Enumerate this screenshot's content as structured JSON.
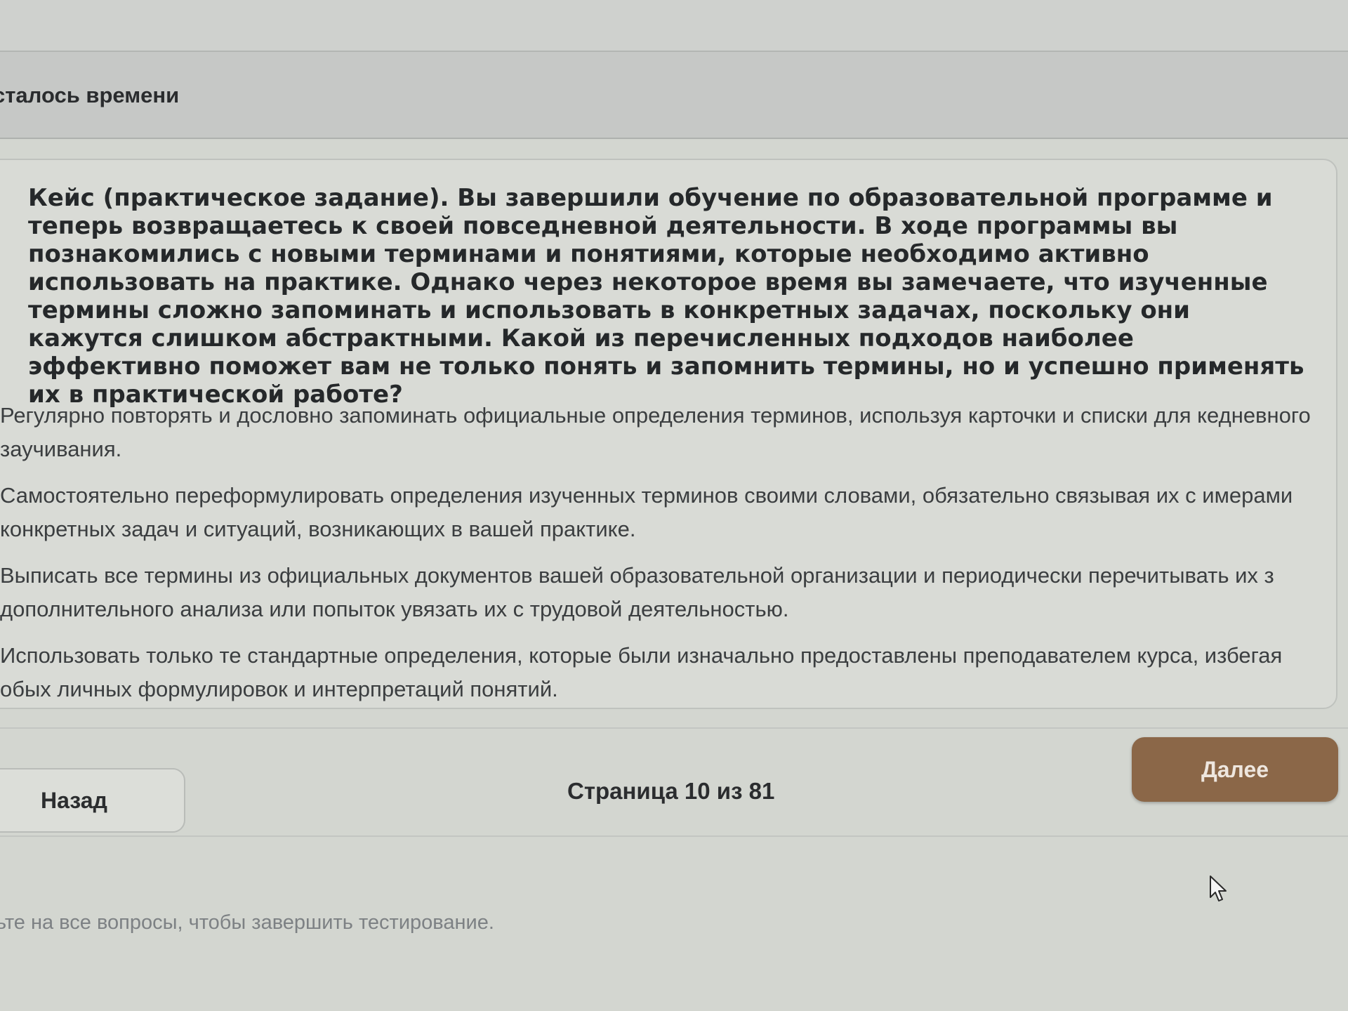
{
  "header": {
    "timer_label": "сталось времени"
  },
  "question": {
    "number": ".",
    "text": "Кейс (практическое задание). Вы завершили обучение по образовательной программе и теперь возвращаетесь к своей повседневной деятельности. В ходе программы вы познакомились с новыми терминами и понятиями, которые необходимо активно использовать на практике. Однако через некоторое время вы замечаете, что изученные термины сложно запоминать и использовать в конкретных задачах, поскольку они кажутся слишком абстрактными. Какой из перечисленных подходов наиболее эффективно поможет вам не только понять и запомнить термины, но и успешно применять их в практической работе?"
  },
  "options": [
    {
      "text": "Регулярно повторять и дословно запоминать официальные определения терминов, используя карточки и списки для кедневного заучивания."
    },
    {
      "text": "Самостоятельно переформулировать определения изученных терминов своими словами, обязательно связывая их с имерами конкретных задач и ситуаций, возникающих в вашей практике."
    },
    {
      "text": "Выписать все термины из официальных документов вашей образовательной организации и периодически перечитывать их з дополнительного анализа или попыток увязать их с трудовой деятельностью."
    },
    {
      "text": "Использовать только те стандартные определения, которые были изначально предоставлены преподавателем курса, избегая обых личных формулировок и интерпретаций понятий."
    }
  ],
  "navigation": {
    "back_label": "Назад",
    "page_indicator": "Страница 10 из 81",
    "next_label": "Далее"
  },
  "footer": {
    "note": "ьте на все вопросы, чтобы завершить тестирование."
  },
  "colors": {
    "next_button": "#8b6748",
    "background": "#d3d6d0"
  }
}
